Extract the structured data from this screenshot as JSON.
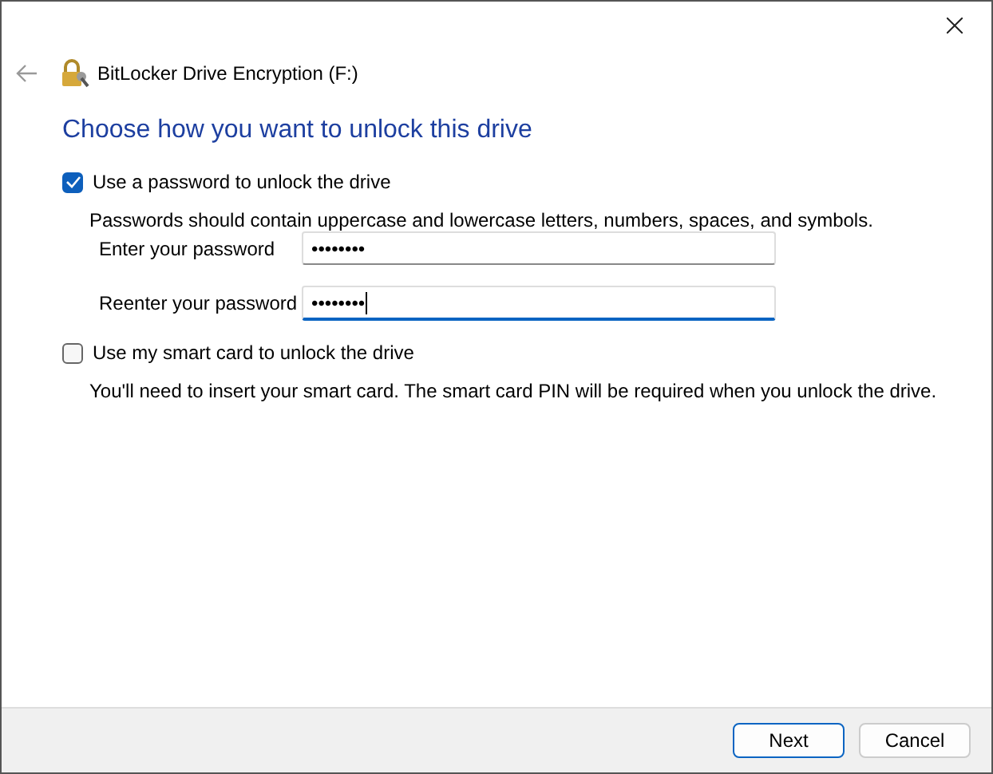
{
  "window": {
    "title": "BitLocker Drive Encryption (F:)"
  },
  "heading": "Choose how you want to unlock this drive",
  "options": [
    {
      "label": "Use a password to unlock the drive",
      "checked": true,
      "description": "Passwords should contain uppercase and lowercase letters, numbers, spaces, and symbols.",
      "fields": [
        {
          "label": "Enter your password",
          "value": "••••••••",
          "focused": false
        },
        {
          "label": "Reenter your password",
          "value": "••••••••",
          "focused": true
        }
      ]
    },
    {
      "label": "Use my smart card to unlock the drive",
      "checked": false,
      "description": "You'll need to insert your smart card. The smart card PIN will be required when you unlock the drive."
    }
  ],
  "buttons": [
    {
      "label": "Next",
      "default": true
    },
    {
      "label": "Cancel",
      "default": false
    }
  ]
}
